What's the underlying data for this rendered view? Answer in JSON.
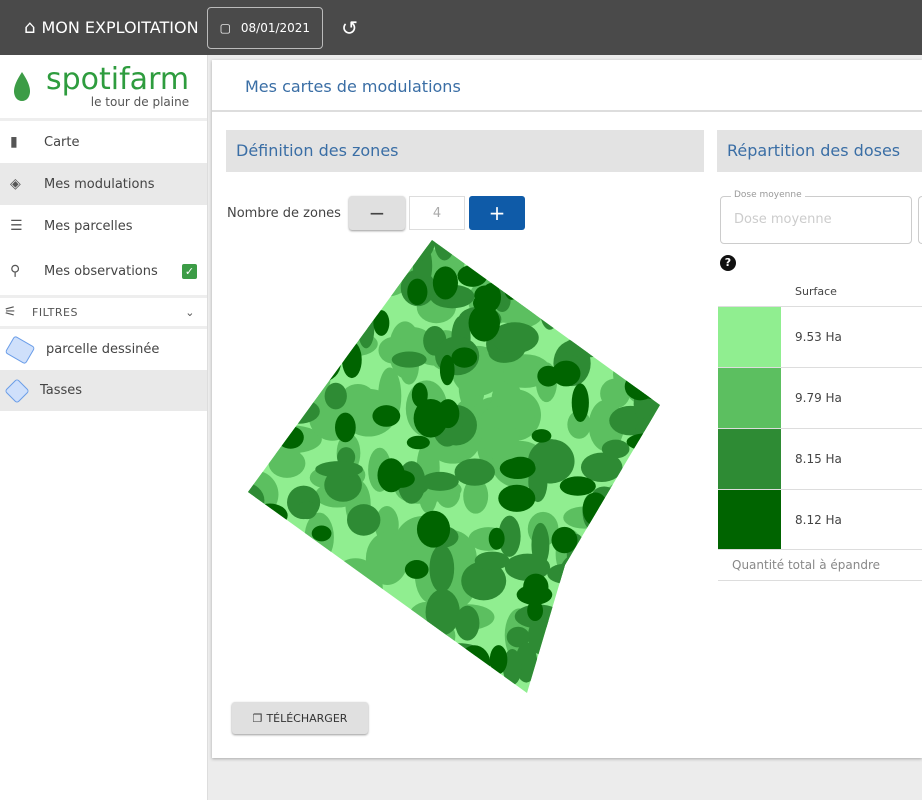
{
  "topbar": {
    "farm_label": "MON EXPLOITATION",
    "date": "08/01/2021"
  },
  "logo": {
    "name": "spotifarm",
    "tagline": "le tour de plaine"
  },
  "sidebar": {
    "items": [
      {
        "label": "Carte",
        "icon": "map-icon"
      },
      {
        "label": "Mes modulations",
        "icon": "modulation-map-icon"
      },
      {
        "label": "Mes parcelles",
        "icon": "list-icon"
      },
      {
        "label": "Mes observations",
        "icon": "location-pin-icon",
        "checked": true
      }
    ],
    "filters_label": "FILTRES",
    "parcels": [
      {
        "label": "parcelle dessinée"
      },
      {
        "label": "Tasses"
      }
    ]
  },
  "main": {
    "title": "Mes cartes de modulations",
    "zones": {
      "title": "Définition des zones",
      "count_label": "Nombre de zones",
      "count": "4",
      "minus": "−",
      "plus": "+",
      "download": "TÉLÉCHARGER"
    },
    "doses": {
      "title": "Répartition des doses",
      "dose_label": "Dose moyenne",
      "dose_placeholder": "Dose moyenne",
      "surface_header": "Surface",
      "rows": [
        {
          "color": "#90ee90",
          "surface": "9.53 Ha"
        },
        {
          "color": "#5cbf60",
          "surface": "9.79 Ha"
        },
        {
          "color": "#2e8b34",
          "surface": "8.15 Ha"
        },
        {
          "color": "#006400",
          "surface": "8.12 Ha"
        }
      ],
      "total_label": "Quantité total à épandre"
    }
  }
}
